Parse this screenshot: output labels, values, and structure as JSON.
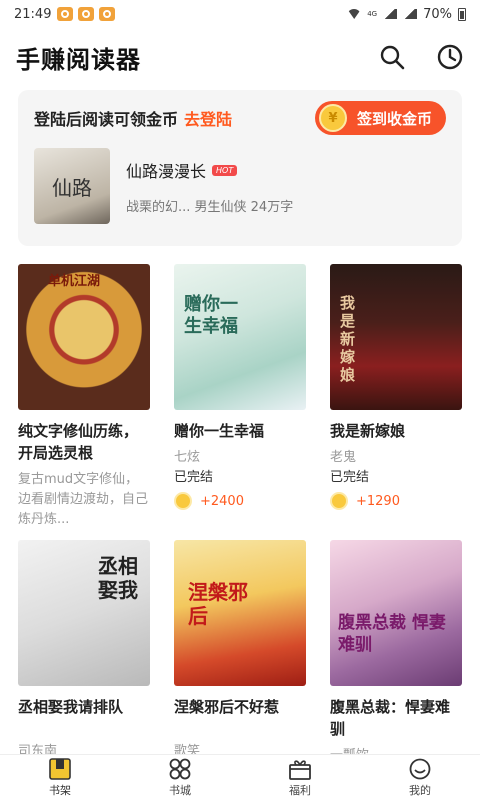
{
  "status_bar": {
    "time": "21:49",
    "battery": "70%",
    "network": "4G"
  },
  "header": {
    "title": "手赚阅读器"
  },
  "login_card": {
    "prompt": "登陆后阅读可领金币",
    "login_link": "去登陆",
    "signin_button": "签到收金币",
    "recommended": {
      "title": "仙路漫漫长",
      "badge": "HOT",
      "meta": "战栗的幻... 男生仙侠 24万字",
      "cover_text": "仙路"
    }
  },
  "books": [
    {
      "title": "纯文字修仙历练，开局选灵根",
      "desc": "复古mud文字修仙，边看剧情边渡劫，自己炼丹炼...",
      "cover_text": "单机江湖"
    },
    {
      "title": "赠你一生幸福",
      "author": "七炫",
      "status": "已完结",
      "coins": "+2400",
      "cover_text": "赠你一生幸福"
    },
    {
      "title": "我是新嫁娘",
      "author": "老鬼",
      "status": "已完结",
      "coins": "+1290",
      "cover_text": "我是新嫁娘"
    },
    {
      "title": "丞相娶我请排队",
      "author": "司东南",
      "cover_text": "丞相娶我"
    },
    {
      "title": "涅槃邪后不好惹",
      "author": "歌笑",
      "cover_text": "涅槃邪后"
    },
    {
      "title": "腹黑总裁：悍妻难驯",
      "author": "一瓢饮",
      "cover_text": "腹黑总裁 悍妻难驯"
    }
  ],
  "tabbar": [
    {
      "label": "书架",
      "icon": "bookshelf-icon",
      "active": true
    },
    {
      "label": "书城",
      "icon": "grid-icon"
    },
    {
      "label": "福利",
      "icon": "gift-icon"
    },
    {
      "label": "我的",
      "icon": "smile-icon"
    }
  ],
  "colors": {
    "accent": "#f7532a",
    "link": "#ff5a1f",
    "coin": "#f9c93d"
  }
}
